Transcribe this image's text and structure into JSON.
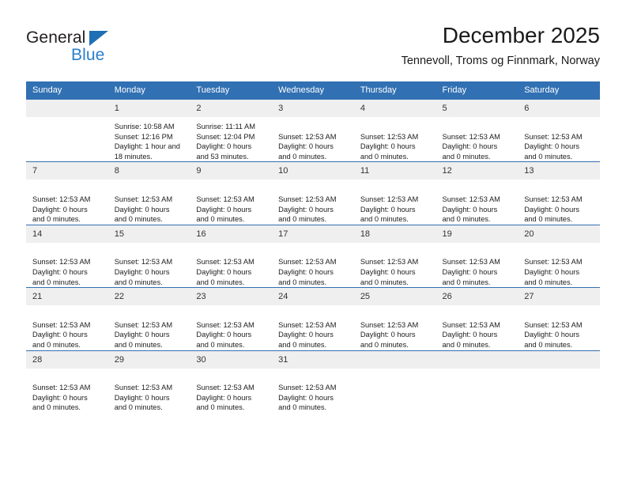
{
  "brand": {
    "name_part1": "General",
    "name_part2": "Blue",
    "triangle_icon": "triangle-icon"
  },
  "header": {
    "title": "December 2025",
    "subtitle": "Tennevoll, Troms og Finnmark, Norway"
  },
  "colors": {
    "header_blue": "#3170b3",
    "logo_blue": "#2a7fc9",
    "daynum_band": "#efefef",
    "row_rule": "#3170b3"
  },
  "calendar": {
    "weekday_headers": [
      "Sunday",
      "Monday",
      "Tuesday",
      "Wednesday",
      "Thursday",
      "Friday",
      "Saturday"
    ],
    "weeks": [
      [
        {
          "day": "",
          "lines": []
        },
        {
          "day": "1",
          "lines": [
            "Sunrise: 10:58 AM",
            "Sunset: 12:16 PM",
            "Daylight: 1 hour and 18 minutes."
          ]
        },
        {
          "day": "2",
          "lines": [
            "Sunrise: 11:11 AM",
            "Sunset: 12:04 PM",
            "Daylight: 0 hours and 53 minutes."
          ]
        },
        {
          "day": "3",
          "lines": [
            "",
            "Sunset: 12:53 AM",
            "Daylight: 0 hours and 0 minutes."
          ]
        },
        {
          "day": "4",
          "lines": [
            "",
            "Sunset: 12:53 AM",
            "Daylight: 0 hours and 0 minutes."
          ]
        },
        {
          "day": "5",
          "lines": [
            "",
            "Sunset: 12:53 AM",
            "Daylight: 0 hours and 0 minutes."
          ]
        },
        {
          "day": "6",
          "lines": [
            "",
            "Sunset: 12:53 AM",
            "Daylight: 0 hours and 0 minutes."
          ]
        }
      ],
      [
        {
          "day": "7",
          "lines": [
            "",
            "Sunset: 12:53 AM",
            "Daylight: 0 hours and 0 minutes."
          ]
        },
        {
          "day": "8",
          "lines": [
            "",
            "Sunset: 12:53 AM",
            "Daylight: 0 hours and 0 minutes."
          ]
        },
        {
          "day": "9",
          "lines": [
            "",
            "Sunset: 12:53 AM",
            "Daylight: 0 hours and 0 minutes."
          ]
        },
        {
          "day": "10",
          "lines": [
            "",
            "Sunset: 12:53 AM",
            "Daylight: 0 hours and 0 minutes."
          ]
        },
        {
          "day": "11",
          "lines": [
            "",
            "Sunset: 12:53 AM",
            "Daylight: 0 hours and 0 minutes."
          ]
        },
        {
          "day": "12",
          "lines": [
            "",
            "Sunset: 12:53 AM",
            "Daylight: 0 hours and 0 minutes."
          ]
        },
        {
          "day": "13",
          "lines": [
            "",
            "Sunset: 12:53 AM",
            "Daylight: 0 hours and 0 minutes."
          ]
        }
      ],
      [
        {
          "day": "14",
          "lines": [
            "",
            "Sunset: 12:53 AM",
            "Daylight: 0 hours and 0 minutes."
          ]
        },
        {
          "day": "15",
          "lines": [
            "",
            "Sunset: 12:53 AM",
            "Daylight: 0 hours and 0 minutes."
          ]
        },
        {
          "day": "16",
          "lines": [
            "",
            "Sunset: 12:53 AM",
            "Daylight: 0 hours and 0 minutes."
          ]
        },
        {
          "day": "17",
          "lines": [
            "",
            "Sunset: 12:53 AM",
            "Daylight: 0 hours and 0 minutes."
          ]
        },
        {
          "day": "18",
          "lines": [
            "",
            "Sunset: 12:53 AM",
            "Daylight: 0 hours and 0 minutes."
          ]
        },
        {
          "day": "19",
          "lines": [
            "",
            "Sunset: 12:53 AM",
            "Daylight: 0 hours and 0 minutes."
          ]
        },
        {
          "day": "20",
          "lines": [
            "",
            "Sunset: 12:53 AM",
            "Daylight: 0 hours and 0 minutes."
          ]
        }
      ],
      [
        {
          "day": "21",
          "lines": [
            "",
            "Sunset: 12:53 AM",
            "Daylight: 0 hours and 0 minutes."
          ]
        },
        {
          "day": "22",
          "lines": [
            "",
            "Sunset: 12:53 AM",
            "Daylight: 0 hours and 0 minutes."
          ]
        },
        {
          "day": "23",
          "lines": [
            "",
            "Sunset: 12:53 AM",
            "Daylight: 0 hours and 0 minutes."
          ]
        },
        {
          "day": "24",
          "lines": [
            "",
            "Sunset: 12:53 AM",
            "Daylight: 0 hours and 0 minutes."
          ]
        },
        {
          "day": "25",
          "lines": [
            "",
            "Sunset: 12:53 AM",
            "Daylight: 0 hours and 0 minutes."
          ]
        },
        {
          "day": "26",
          "lines": [
            "",
            "Sunset: 12:53 AM",
            "Daylight: 0 hours and 0 minutes."
          ]
        },
        {
          "day": "27",
          "lines": [
            "",
            "Sunset: 12:53 AM",
            "Daylight: 0 hours and 0 minutes."
          ]
        }
      ],
      [
        {
          "day": "28",
          "lines": [
            "",
            "Sunset: 12:53 AM",
            "Daylight: 0 hours and 0 minutes."
          ]
        },
        {
          "day": "29",
          "lines": [
            "",
            "Sunset: 12:53 AM",
            "Daylight: 0 hours and 0 minutes."
          ]
        },
        {
          "day": "30",
          "lines": [
            "",
            "Sunset: 12:53 AM",
            "Daylight: 0 hours and 0 minutes."
          ]
        },
        {
          "day": "31",
          "lines": [
            "",
            "Sunset: 12:53 AM",
            "Daylight: 0 hours and 0 minutes."
          ]
        },
        {
          "day": "",
          "lines": []
        },
        {
          "day": "",
          "lines": []
        },
        {
          "day": "",
          "lines": []
        }
      ]
    ]
  }
}
